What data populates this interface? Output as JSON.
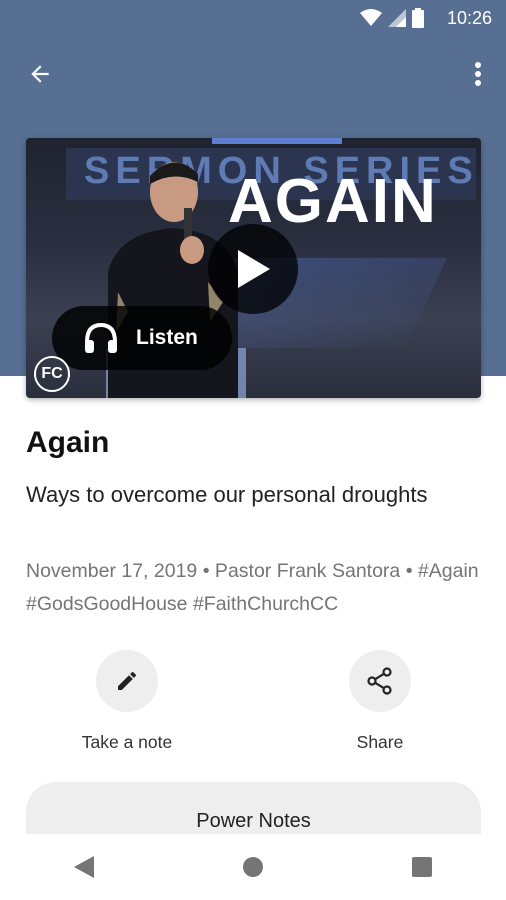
{
  "status_bar": {
    "time": "10:26"
  },
  "media": {
    "series_text": "SERMON SERIES",
    "overlay_title": "AGAIN",
    "listen_label": "Listen",
    "logo_text": "FC"
  },
  "sermon": {
    "title": "Again",
    "subtitle": "Ways to overcome our personal droughts",
    "meta": "November 17, 2019 • Pastor Frank Santora • #Again #GodsGoodHouse #FaithChurchCC"
  },
  "actions": {
    "note_label": "Take a note",
    "share_label": "Share"
  },
  "power_notes_label": "Power Notes",
  "icons": {
    "back": "arrow-left-icon",
    "more": "more-vert-icon",
    "play": "play-icon",
    "listen": "headphones-icon",
    "note": "pencil-icon",
    "share": "share-icon"
  },
  "colors": {
    "header": "#566f92",
    "action_bg": "#eeeeee"
  }
}
